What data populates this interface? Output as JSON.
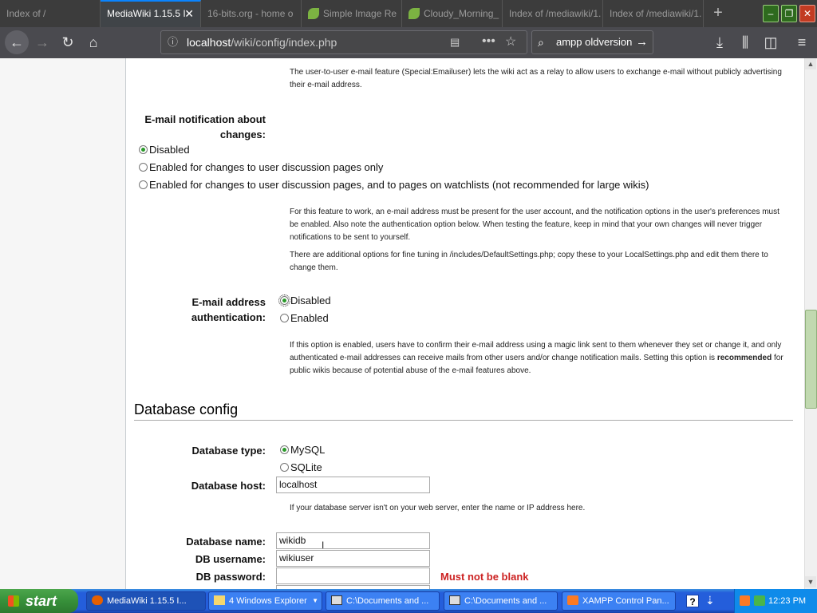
{
  "browser": {
    "tabs": [
      {
        "title": "Index of /",
        "active": false
      },
      {
        "title": "MediaWiki 1.15.5 I",
        "active": true
      },
      {
        "title": "16-bits.org - home o",
        "active": false
      },
      {
        "title": "Simple Image Re",
        "active": false
      },
      {
        "title": "Cloudy_Morning_",
        "active": false
      },
      {
        "title": "Index of /mediawiki/1.",
        "active": false
      },
      {
        "title": "Index of /mediawiki/1.",
        "active": false
      }
    ],
    "url_host": "localhost",
    "url_path": "/wiki/config/index.php",
    "search_text": "ampp oldversion"
  },
  "page": {
    "emailuser_note": "The user-to-user e-mail feature (Special:Emailuser) lets the wiki act as a relay to allow users to exchange e-mail without publicly advertising their e-mail address.",
    "enotif": {
      "label": "E-mail notification about changes:",
      "options": [
        "Disabled",
        "Enabled for changes to user discussion pages only",
        "Enabled for changes to user discussion pages, and to pages on watchlists (not recommended for large wikis)"
      ],
      "selected_index": 0,
      "note1": "For this feature to work, an e-mail address must be present for the user account, and the notification options in the user's preferences must be enabled. Also note the authentication option below. When testing the feature, keep in mind that your own changes will never trigger notifications to be sent to yourself.",
      "note2": "There are additional options for fine tuning in /includes/DefaultSettings.php; copy these to your LocalSettings.php and edit them there to change them."
    },
    "eauth": {
      "label": "E-mail address authentication:",
      "options": [
        "Disabled",
        "Enabled"
      ],
      "selected_index": 0,
      "note_before": "If this option is enabled, users have to confirm their e-mail address using a magic link sent to them whenever they set or change it, and only authenticated e-mail addresses can receive mails from other users and/or change notification mails. Setting this option is ",
      "note_bold": "recommended",
      "note_after": " for public wikis because of potential abuse of the e-mail features above."
    },
    "db_section_title": "Database config",
    "db_type": {
      "label": "Database type:",
      "options": [
        "MySQL",
        "SQLite"
      ],
      "selected_index": 0
    },
    "db_host": {
      "label": "Database host:",
      "value": "localhost",
      "note": "If your database server isn't on your web server, enter the name or IP address here."
    },
    "db_name": {
      "label": "Database name:",
      "value": "wikidb"
    },
    "db_user": {
      "label": "DB username:",
      "value": "wikiuser"
    },
    "db_password": {
      "label": "DB password:",
      "value": "",
      "error": "Must not be blank"
    }
  },
  "taskbar": {
    "start_label": "start",
    "tasks": [
      "MediaWiki 1.15.5 I...",
      "4 Windows Explorer",
      "C:\\Documents and ...",
      "C:\\Documents and ...",
      "XAMPP Control Pan..."
    ],
    "clock": "12:23 PM"
  },
  "colors": {
    "error_text": "#cc2222",
    "radio_selected": "#2a9a2a",
    "taskbar_blue": "#245edb",
    "start_green": "#37903a"
  }
}
